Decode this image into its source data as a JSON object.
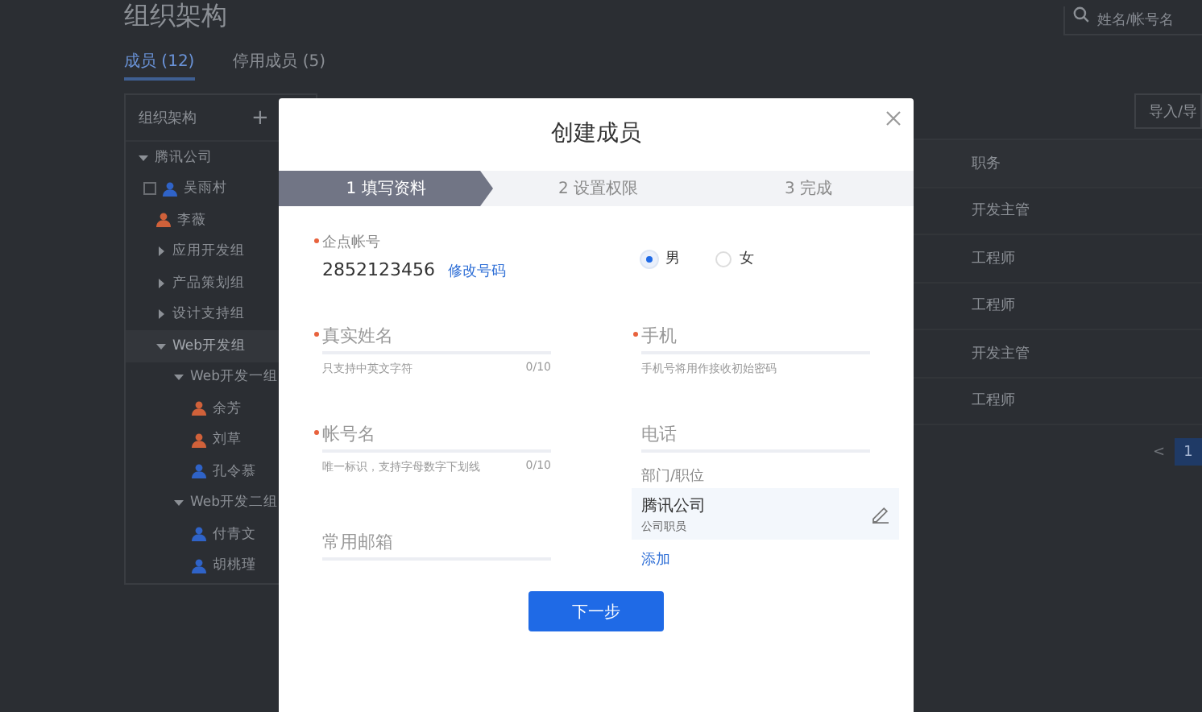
{
  "page": {
    "title": "组织架构",
    "tabs": [
      {
        "label": "成员 (12)",
        "selected": true
      },
      {
        "label": "停用成员 (5)",
        "selected": false
      }
    ],
    "search": {
      "placeholder": "姓名/帐号名"
    },
    "tree_panel": {
      "title": "组织架构",
      "add_label": "+",
      "tree": [
        {
          "kind": "group",
          "label": "腾讯公司",
          "expanded": true,
          "selected": false,
          "children": [
            {
              "kind": "person",
              "label": "吴雨村",
              "color": "#2f63c8",
              "hovered": true,
              "checked": false
            },
            {
              "kind": "person",
              "label": "李薇",
              "color": "#d0613a",
              "hovered": false
            },
            {
              "kind": "group",
              "label": "应用开发组",
              "expanded": false,
              "selected": false
            },
            {
              "kind": "group",
              "label": "产品策划组",
              "expanded": false,
              "selected": false
            },
            {
              "kind": "group",
              "label": "设计支持组",
              "expanded": false,
              "selected": false
            },
            {
              "kind": "group",
              "label": "Web开发组",
              "expanded": true,
              "selected": true,
              "children": [
                {
                  "kind": "group",
                  "label": "Web开发一组",
                  "expanded": true,
                  "selected": false,
                  "children": [
                    {
                      "kind": "person",
                      "label": "余芳",
                      "color": "#d0613a",
                      "hovered": false
                    },
                    {
                      "kind": "person",
                      "label": "刘草",
                      "color": "#d0613a",
                      "hovered": false
                    },
                    {
                      "kind": "person",
                      "label": "孔令慕",
                      "color": "#2f63c8",
                      "hovered": false
                    }
                  ]
                },
                {
                  "kind": "group",
                  "label": "Web开发二组",
                  "expanded": true,
                  "selected": false,
                  "children": [
                    {
                      "kind": "person",
                      "label": "付青文",
                      "color": "#2f63c8",
                      "hovered": false
                    },
                    {
                      "kind": "person",
                      "label": "胡桃瑾",
                      "color": "#2f63c8",
                      "hovered": false
                    }
                  ]
                }
              ]
            }
          ]
        }
      ]
    },
    "import_button": "导入/导",
    "table": {
      "columns": [
        "职务"
      ],
      "rows": [
        [
          "开发主管"
        ],
        [
          "工程师"
        ],
        [
          "工程师"
        ],
        [
          "开发主管"
        ],
        [
          "工程师"
        ]
      ]
    },
    "pagination": {
      "prev": "<",
      "pages": [
        {
          "label": "1",
          "selected": true
        }
      ]
    }
  },
  "dialog": {
    "title": "创建成员",
    "steps": [
      {
        "label": "1 填写资料",
        "selected": true
      },
      {
        "label": "2 设置权限",
        "selected": false
      },
      {
        "label": "3 完成",
        "selected": false
      }
    ],
    "account": {
      "label": "企点帐号",
      "required": true,
      "value": "2852123456",
      "link": "修改号码"
    },
    "gender": [
      {
        "label": "男",
        "selected": true
      },
      {
        "label": "女",
        "selected": false
      }
    ],
    "fields": [
      {
        "placeholder": "真实姓名",
        "required": true,
        "hint": "只支持中英文字符",
        "count": "0/10"
      },
      {
        "placeholder": "手机",
        "required": true,
        "hint": "手机号将用作接收初始密码"
      },
      {
        "placeholder": "帐号名",
        "required": true,
        "hint": "唯一标识，支持字母数字下划线",
        "count": "0/10"
      },
      {
        "placeholder": "电话",
        "required": false
      },
      {
        "placeholder": "常用邮箱",
        "required": false
      }
    ],
    "department": {
      "label": "部门/职位",
      "name": "腾讯公司",
      "role": "公司职员",
      "add_link": "添加"
    },
    "next_button": "下一步"
  }
}
